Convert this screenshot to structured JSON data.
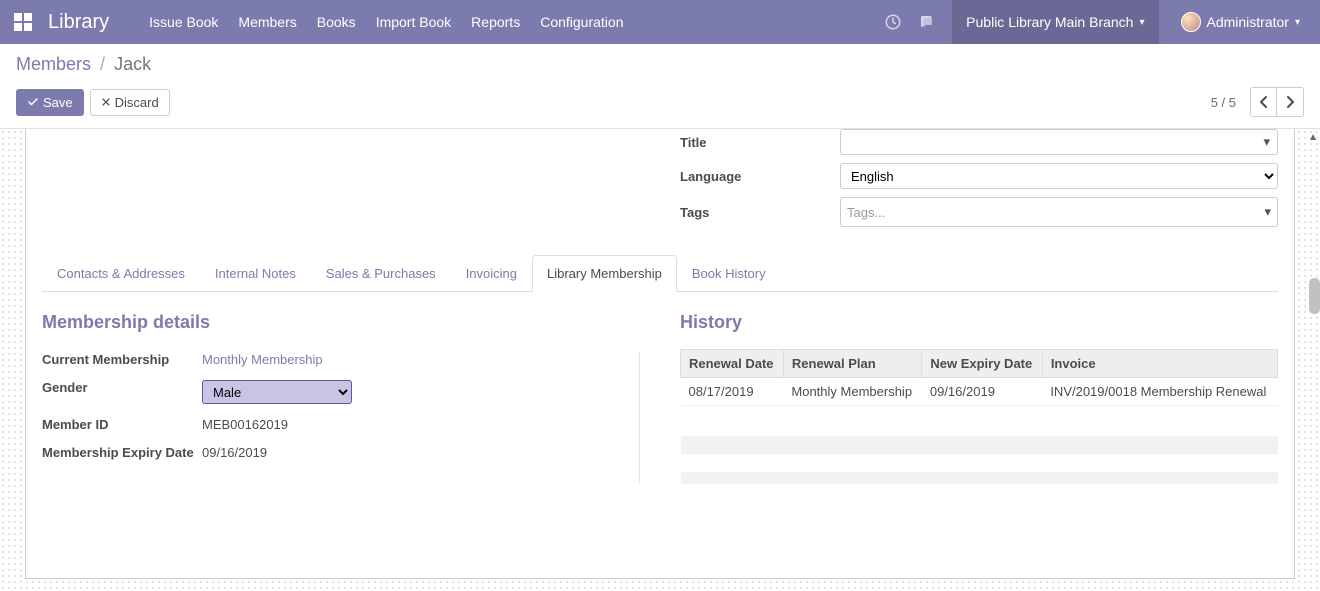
{
  "topnav": {
    "brand": "Library",
    "menu": [
      "Issue Book",
      "Members",
      "Books",
      "Import Book",
      "Reports",
      "Configuration"
    ],
    "branch": "Public Library Main Branch",
    "user": "Administrator"
  },
  "breadcrumb": {
    "parent": "Members",
    "current": "Jack"
  },
  "actions": {
    "save": "Save",
    "discard": "Discard",
    "pager": "5 / 5"
  },
  "fields": {
    "title_label": "Title",
    "title_value": "",
    "language_label": "Language",
    "language_value": "English",
    "tags_label": "Tags",
    "tags_placeholder": "Tags..."
  },
  "tabs": [
    "Contacts & Addresses",
    "Internal Notes",
    "Sales & Purchases",
    "Invoicing",
    "Library Membership",
    "Book History"
  ],
  "active_tab_index": 4,
  "membership": {
    "heading": "Membership details",
    "current_label": "Current Membership",
    "current_value": "Monthly Membership",
    "gender_label": "Gender",
    "gender_value": "Male",
    "member_id_label": "Member ID",
    "member_id_value": "MEB00162019",
    "expiry_label": "Membership Expiry Date",
    "expiry_value": "09/16/2019"
  },
  "history": {
    "heading": "History",
    "headers": [
      "Renewal Date",
      "Renewal Plan",
      "New Expiry Date",
      "Invoice"
    ],
    "rows": [
      {
        "renewal_date": "08/17/2019",
        "renewal_plan": "Monthly Membership",
        "new_expiry": "09/16/2019",
        "invoice": "INV/2019/0018 Membership Renewal"
      }
    ]
  }
}
